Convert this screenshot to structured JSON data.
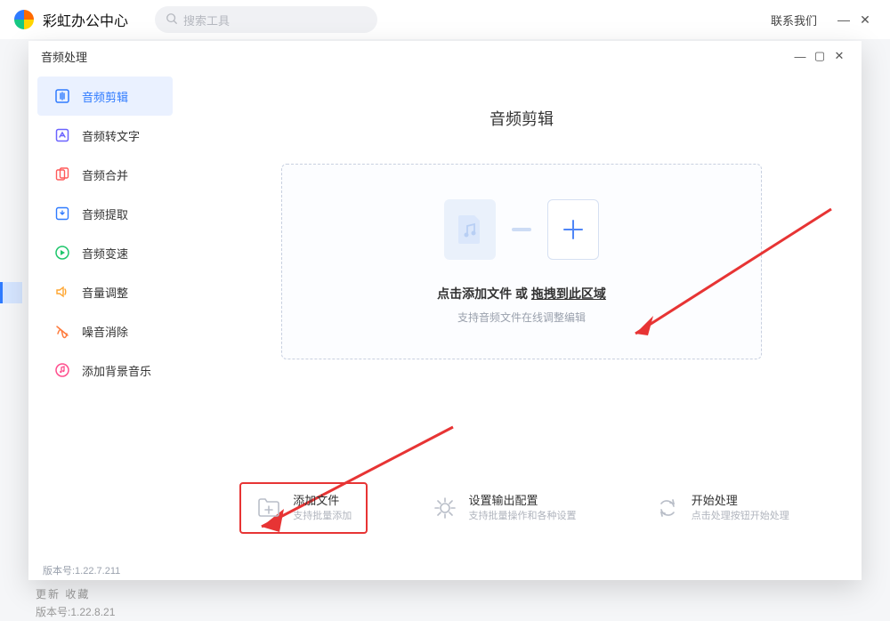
{
  "outer": {
    "title": "彩虹办公中心",
    "search_placeholder": "搜索工具",
    "contact": "联系我们"
  },
  "outer_footer": {
    "line1": "版本号:1.22.8.21",
    "line2": "更新    收藏"
  },
  "modal": {
    "title": "音频处理",
    "version": "版本号:1.22.7.211"
  },
  "sidebar": {
    "items": [
      {
        "label": "音频剪辑",
        "active": true
      },
      {
        "label": "音频转文字",
        "active": false
      },
      {
        "label": "音频合并",
        "active": false
      },
      {
        "label": "音频提取",
        "active": false
      },
      {
        "label": "音频变速",
        "active": false
      },
      {
        "label": "音量调整",
        "active": false
      },
      {
        "label": "噪音消除",
        "active": false
      },
      {
        "label": "添加背景音乐",
        "active": false
      }
    ]
  },
  "main": {
    "heading": "音频剪辑",
    "dropzone": {
      "click": "点击添加文件",
      "or": " 或 ",
      "drag": "拖拽到此区域",
      "sub": "支持音频文件在线调整编辑"
    }
  },
  "actions": {
    "addfile": {
      "title": "添加文件",
      "sub": "支持批量添加"
    },
    "output": {
      "title": "设置输出配置",
      "sub": "支持批量操作和各种设置"
    },
    "start": {
      "title": "开始处理",
      "sub": "点击处理按钮开始处理"
    }
  },
  "colors": {
    "accent": "#2f7bff",
    "highlight": "#e73434"
  }
}
